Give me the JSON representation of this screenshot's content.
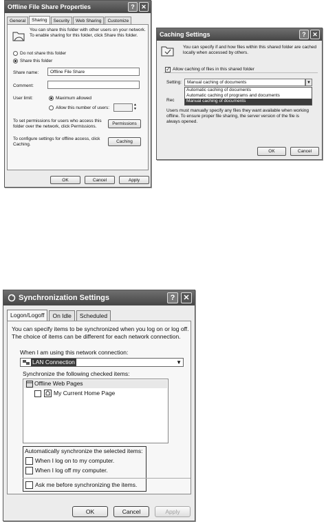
{
  "offline_props": {
    "title": "Offline File Share Properties",
    "tabs": [
      "General",
      "Sharing",
      "Security",
      "Web Sharing",
      "Customize"
    ],
    "intro": "You can share this folder with other users on your network. To enable sharing for this folder, click Share this folder.",
    "radio_not_share": "Do not share this folder",
    "radio_share": "Share this folder",
    "share_name_label": "Share name:",
    "share_name_value": "Offline File Share",
    "comment_label": "Comment:",
    "user_limit_label": "User limit:",
    "max_allowed": "Maximum allowed",
    "allow_number": "Allow this number of users:",
    "permissions_text": "To set permissions for users who access this folder over the network, click Permissions.",
    "permissions_btn": "Permissions",
    "caching_text": "To configure settings for offline access, click Caching.",
    "caching_btn": "Caching",
    "ok": "OK",
    "cancel": "Cancel",
    "apply": "Apply"
  },
  "caching": {
    "title": "Caching Settings",
    "intro": "You can specify if and how files within this shared folder are cached locally when accessed by others.",
    "allow_caching": "Allow caching of files in this shared folder",
    "setting_label": "Setting:",
    "setting_value": "Manual caching of documents",
    "options": [
      "Automatic caching of documents",
      "Automatic caching of programs and documents",
      "Manual caching of documents"
    ],
    "partial_label": "Rec",
    "note": "Users must manually specify any files they want available when working offline. To ensure proper file sharing, the server version of the file is always opened.",
    "ok": "OK",
    "cancel": "Cancel"
  },
  "sync": {
    "title": "Synchronization Settings",
    "tabs": [
      "Logon/Logoff",
      "On Idle",
      "Scheduled"
    ],
    "intro1": "You can specify items to be synchronized when you log on or log off.",
    "intro2": "The choice of items can be different for each network connection.",
    "connection_label": "When I am using this network connection:",
    "connection_value": "LAN Connection",
    "items_label": "Synchronize the following checked items:",
    "item_group": "Offline Web Pages",
    "item_child": "My Current Home Page",
    "auto_label": "Automatically synchronize the selected items:",
    "opt_logon": "When I log on to my computer.",
    "opt_logoff": "When I log off my computer.",
    "opt_ask": "Ask me before synchronizing the items.",
    "ok": "OK",
    "cancel": "Cancel",
    "apply": "Apply"
  }
}
